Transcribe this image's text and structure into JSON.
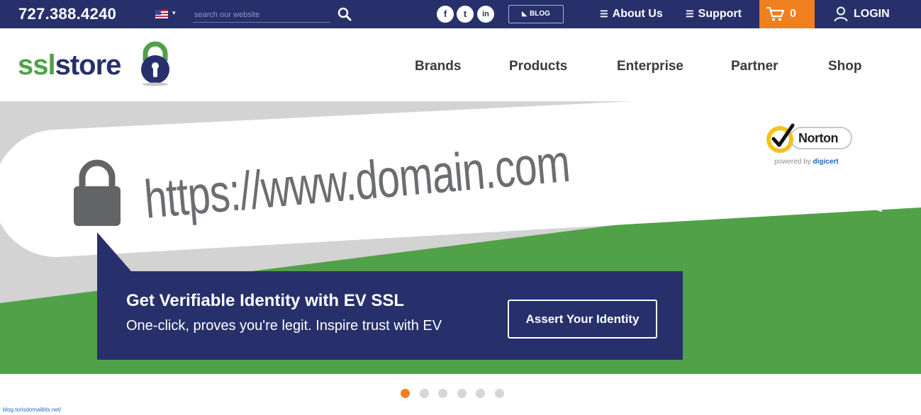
{
  "topbar": {
    "phone": "727.388.4240",
    "search_placeholder": "search our website",
    "blog_label": "BLOG",
    "about_label": "About Us",
    "support_label": "Support",
    "cart_count": "0",
    "login_label": "LOGIN",
    "social": {
      "facebook": "f",
      "twitter": "t",
      "linkedin": "in"
    }
  },
  "logo": {
    "part1": "ssl",
    "part2": "store"
  },
  "nav": {
    "items": [
      {
        "label": "Brands"
      },
      {
        "label": "Products"
      },
      {
        "label": "Enterprise"
      },
      {
        "label": "Partner"
      },
      {
        "label": "Shop"
      }
    ]
  },
  "hero": {
    "url_text": "https://www.domain.com",
    "callout_title": "Get Verifiable Identity with EV SSL",
    "callout_subtitle": "One-click, proves you're legit. Inspire trust with EV",
    "cta_label": "Assert Your Identity",
    "badge": {
      "name": "Norton",
      "powered_prefix": "powered by ",
      "powered_brand": "digicert"
    }
  },
  "carousel": {
    "active_index": 0,
    "slide_count": 6
  },
  "status_link": "blog.torisdomaibits.net/",
  "colors": {
    "navy": "#27306b",
    "orange": "#f07f1e",
    "green": "#4fa14a",
    "hero_grey": "#d3d3d3"
  },
  "icons": [
    "us-flag-icon",
    "search-icon",
    "facebook-icon",
    "twitter-icon",
    "linkedin-icon",
    "rss-icon",
    "menu-icon",
    "cart-icon",
    "user-icon",
    "padlock-icon",
    "norton-check-icon"
  ]
}
